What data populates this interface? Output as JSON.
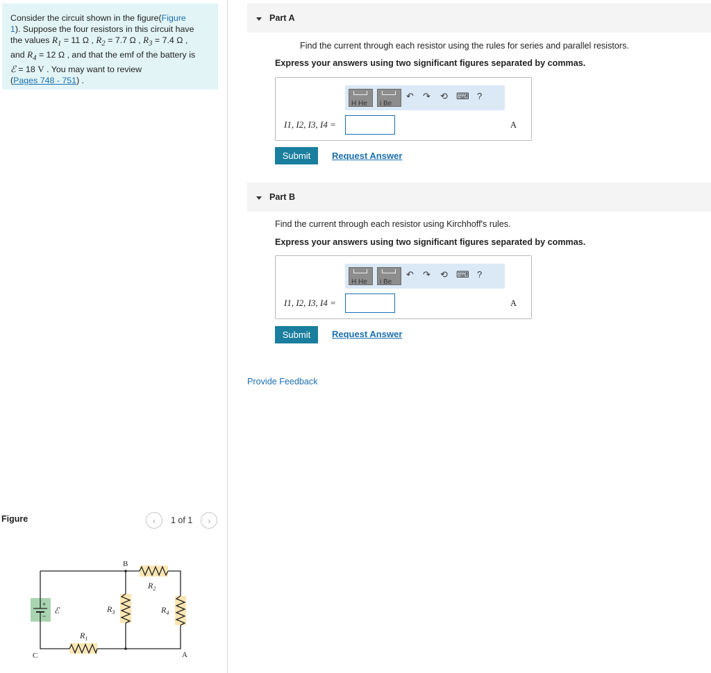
{
  "problem": {
    "line1_prefix": "Consider the circuit shown in the figure(",
    "line1_link": "Figure",
    "line2_link": "1",
    "line2_suffix": "). Suppose the four resistors in this circuit have",
    "line3_a": "the values ",
    "r1_sym": "R",
    "r1_sub": "1",
    "r1_val": " = 11 Ω , ",
    "r2_sym": "R",
    "r2_sub": "2",
    "r2_val": " = 7.7 Ω , ",
    "r3_sym": "R",
    "r3_sub": "3",
    "r3_val": " = 7.4 Ω ,",
    "line4_a": "and ",
    "r4_sym": "R",
    "r4_sub": "4",
    "r4_val": " = 12 Ω , and that the emf of the battery is",
    "emf_sym": "ℰ",
    "emf_val": " = 18 ",
    "emf_unit": "V",
    "line5_suffix": " . You may want to review",
    "pages_open": "(",
    "pages_link": "Pages 748 - 751",
    "pages_close": ") ."
  },
  "figure": {
    "label": "Figure",
    "pager_text": "1 of 1",
    "prev_icon": "chevron-left-icon",
    "next_icon": "chevron-right-icon",
    "labels": {
      "B": "B",
      "R2": "R",
      "R2_sub": "2",
      "R3": "R",
      "R3_sub": "3",
      "R4": "R",
      "R4_sub": "4",
      "R1": "R",
      "R1_sub": "1",
      "emf": "ℰ",
      "C": "C",
      "A": "A",
      "plus": "+",
      "minus": "−"
    }
  },
  "partA": {
    "title": "Part A",
    "instruction": "Find the current through each resistor using the rules for series and parallel resistors.",
    "express": "Express your answers using two significant figures separated by commas.",
    "answer_label": "I1, I2, I3, I4 =",
    "input_value": "",
    "unit": "A",
    "submit": "Submit",
    "request": "Request Answer"
  },
  "partB": {
    "title": "Part B",
    "instruction": "Find the current through each resistor using Kirchhoff's rules.",
    "express": "Express your answers using two significant figures separated by commas.",
    "answer_label": "I1, I2, I3, I4 =",
    "input_value": "",
    "unit": "A",
    "submit": "Submit",
    "request": "Request Answer"
  },
  "toolbar": {
    "tile1_text": "H  He",
    "tile2_text": "i  Be",
    "undo_icon": "↶",
    "redo_icon": "↷",
    "reset_icon": "⟲",
    "keyboard_icon": "⌨",
    "help_icon": "?"
  },
  "feedback": "Provide Feedback",
  "colors": {
    "problem_bg": "#e3f4f6",
    "link": "#1a6fb0",
    "submit_bg": "#1a7e9e",
    "toolbar_bg": "#dbe9f6",
    "resistor_bg": "#fbe6b3",
    "battery_bg": "#a9d4b0"
  }
}
